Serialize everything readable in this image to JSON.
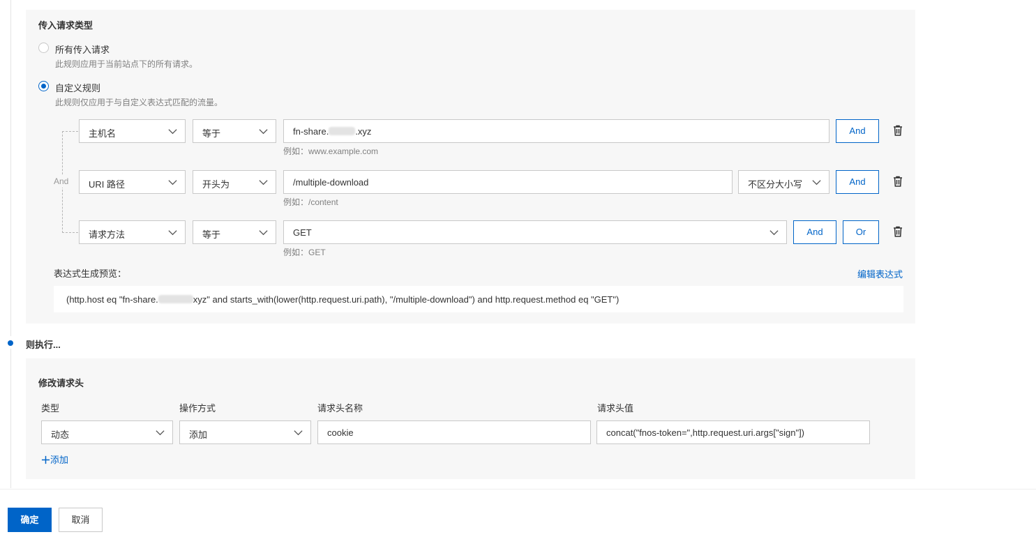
{
  "incoming": {
    "title": "传入请求类型",
    "option_all": {
      "label": "所有传入请求",
      "desc": "此规则应用于当前站点下的所有请求。",
      "checked": false
    },
    "option_custom": {
      "label": "自定义规则",
      "desc": "此规则仅应用于与自定义表达式匹配的流量。",
      "checked": true
    },
    "group_operator": "And",
    "rules": [
      {
        "field": "主机名",
        "operator": "等于",
        "value_prefix": "fn-share.",
        "value_suffix": ".xyz",
        "hint": "例如：www.example.com",
        "and_label": "And"
      },
      {
        "field": "URI 路径",
        "operator": "开头为",
        "value": "/multiple-download",
        "case": "不区分大小写",
        "hint": "例如：/content",
        "and_label": "And"
      },
      {
        "field": "请求方法",
        "operator": "等于",
        "value": "GET",
        "hint": "例如：GET",
        "and_label": "And",
        "or_label": "Or"
      }
    ],
    "preview_label": "表达式生成预览：",
    "edit_expression": "编辑表达式",
    "preview_prefix": "(http.host eq \"fn-share.",
    "preview_suffix": "xyz\" and starts_with(lower(http.request.uri.path), \"/multiple-download\") and http.request.method eq \"GET\")"
  },
  "then": {
    "label": "则执行...",
    "title": "修改请求头",
    "columns": {
      "type": "类型",
      "action": "操作方式",
      "name": "请求头名称",
      "value": "请求头值"
    },
    "row": {
      "type": "动态",
      "action": "添加",
      "name": "cookie",
      "value": "concat(\"fnos-token=\",http.request.uri.args[\"sign\"])"
    },
    "add_label": "添加"
  },
  "footer": {
    "confirm": "确定",
    "cancel": "取消"
  },
  "colors": {
    "accent": "#0064c8",
    "panel": "#f7f7f7",
    "border": "#c8c8c8"
  }
}
